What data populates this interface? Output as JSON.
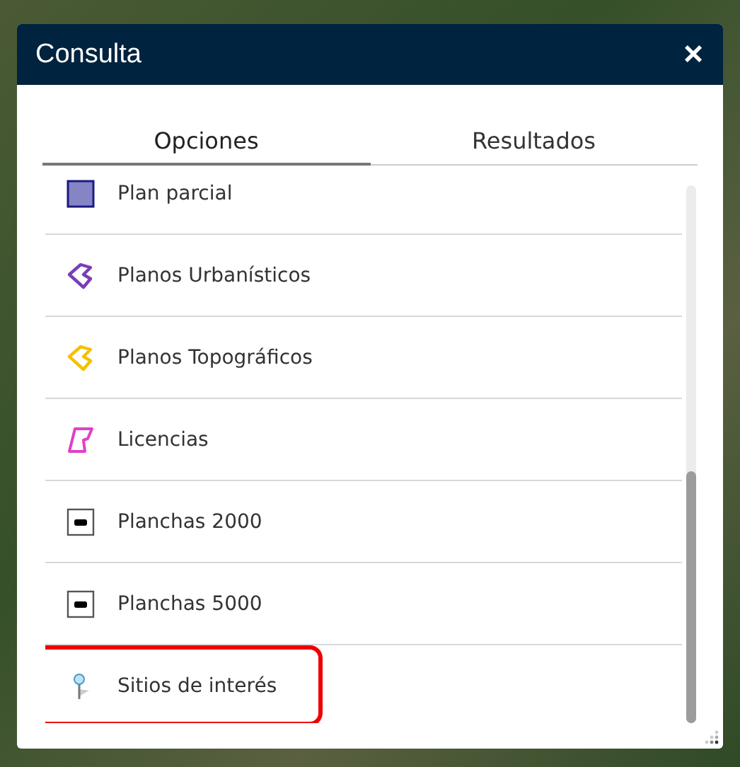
{
  "window": {
    "title": "Consulta",
    "close": "×"
  },
  "tabs": [
    {
      "label": "Opciones",
      "selected": true
    },
    {
      "label": "Resultados",
      "selected": false
    }
  ],
  "layers": [
    {
      "label": "Plan parcial",
      "kind": "square",
      "highlighted": false
    },
    {
      "label": "Planos Urbanísticos",
      "kind": "polygon",
      "color": "#7a3db8",
      "highlighted": false
    },
    {
      "label": "Planos Topográficos",
      "kind": "polygon",
      "color": "#f5c000",
      "highlighted": false
    },
    {
      "label": "Licencias",
      "kind": "parcel",
      "color": "#e040c8",
      "highlighted": false
    },
    {
      "label": "Planchas 2000",
      "kind": "sheet",
      "highlighted": false
    },
    {
      "label": "Planchas 5000",
      "kind": "sheet",
      "highlighted": false
    },
    {
      "label": "Sitios de interés",
      "kind": "pin",
      "highlighted": true
    }
  ]
}
